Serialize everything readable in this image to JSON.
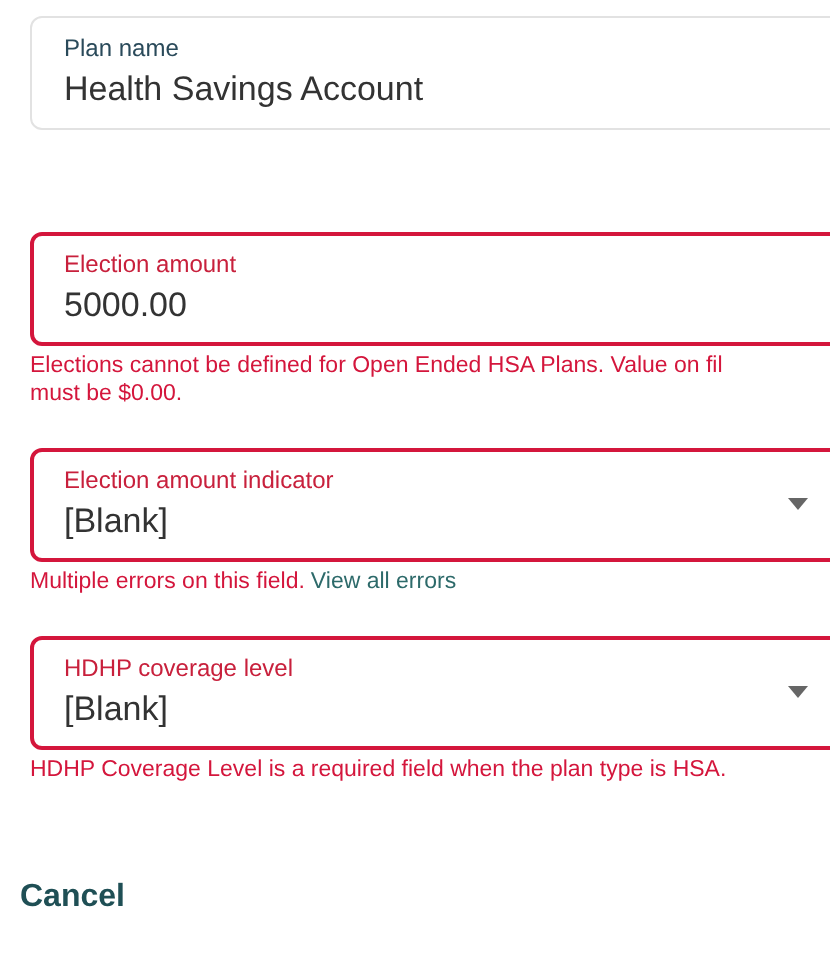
{
  "fields": [
    {
      "kind": "text",
      "label": "Plan name",
      "value": "Health Savings Account",
      "error": false
    },
    {
      "kind": "text",
      "label": "Election amount",
      "value": "5000.00",
      "error": true,
      "message": "Elections cannot be defined for Open Ended HSA Plans. Value on fil\nmust be $0.00."
    },
    {
      "kind": "select",
      "label": "Election amount indicator",
      "value": "[Blank]",
      "error": true,
      "message": "Multiple errors on this field.",
      "link": "View all errors"
    },
    {
      "kind": "select",
      "label": "HDHP coverage level",
      "value": "[Blank]",
      "error": true,
      "message": "HDHP Coverage Level is a required field when the plan type is HSA."
    }
  ],
  "cancel": "Cancel"
}
